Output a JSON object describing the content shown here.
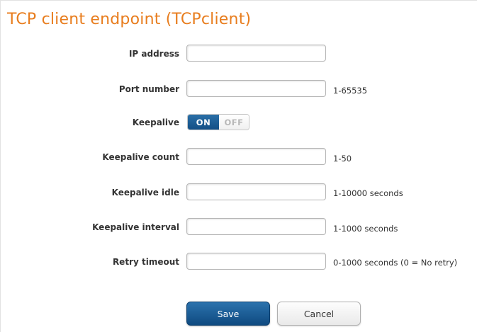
{
  "title": "TCP client endpoint (TCPclient)",
  "fields": {
    "ip_address": {
      "label": "IP address",
      "value": ""
    },
    "port_number": {
      "label": "Port number",
      "value": "",
      "hint": "1-65535"
    },
    "keepalive": {
      "label": "Keepalive",
      "on_label": "ON",
      "off_label": "OFF",
      "state": "ON"
    },
    "keepalive_count": {
      "label": "Keepalive count",
      "value": "",
      "hint": "1-50"
    },
    "keepalive_idle": {
      "label": "Keepalive idle",
      "value": "",
      "hint": "1-10000  seconds"
    },
    "keepalive_interval": {
      "label": "Keepalive interval",
      "value": "",
      "hint": "1-1000  seconds"
    },
    "retry_timeout": {
      "label": "Retry timeout",
      "value": "",
      "hint": "0-1000  seconds (0 = No retry)"
    }
  },
  "buttons": {
    "save": "Save",
    "cancel": "Cancel"
  },
  "colors": {
    "title": "#e87d1e",
    "primary": "#1a5c96",
    "toggle_on": "#1a5c96"
  }
}
